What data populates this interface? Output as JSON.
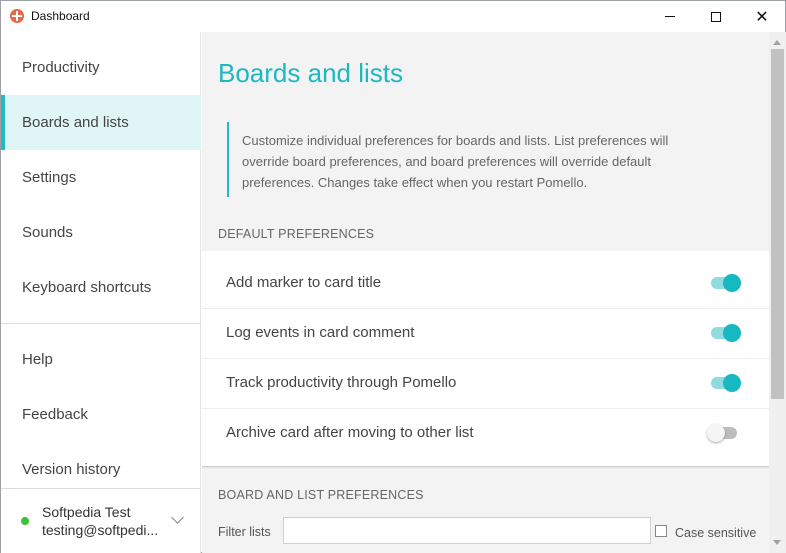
{
  "window": {
    "title": "Dashboard",
    "minimize_icon": "minimize-icon",
    "maximize_icon": "maximize-icon",
    "close_icon": "close-icon",
    "close_glyph": "✕"
  },
  "sidebar": {
    "items": [
      {
        "label": "Productivity",
        "active": false
      },
      {
        "label": "Boards and lists",
        "active": true
      },
      {
        "label": "Settings",
        "active": false
      },
      {
        "label": "Sounds",
        "active": false
      },
      {
        "label": "Keyboard shortcuts",
        "active": false
      }
    ],
    "secondary_items": [
      {
        "label": "Help"
      },
      {
        "label": "Feedback"
      },
      {
        "label": "Version history"
      }
    ],
    "user": {
      "name": "Softpedia Test",
      "email": "testing@softpedi...",
      "status_color": "#3cc23c"
    }
  },
  "main": {
    "title": "Boards and lists",
    "description": "Customize individual preferences for boards and lists. List preferences will override board preferences, and board preferences will override default preferences. Changes take effect when you restart Pomello.",
    "default_section_label": "DEFAULT PREFERENCES",
    "preferences": [
      {
        "label": "Add marker to card title",
        "enabled": true
      },
      {
        "label": "Log events in card comment",
        "enabled": true
      },
      {
        "label": "Track productivity through Pomello",
        "enabled": true
      },
      {
        "label": "Archive card after moving to other list",
        "enabled": false
      }
    ],
    "board_section_label": "BOARD AND LIST PREFERENCES",
    "filter": {
      "label": "Filter lists",
      "value": "",
      "placeholder": ""
    },
    "case_sensitive": {
      "label": "Case sensitive",
      "checked": false
    }
  },
  "colors": {
    "accent": "#1cb8c4",
    "active_nav_bg": "#dff5f6",
    "toggle_on": "#17b8c2",
    "toggle_off": "#bdbdbd"
  }
}
